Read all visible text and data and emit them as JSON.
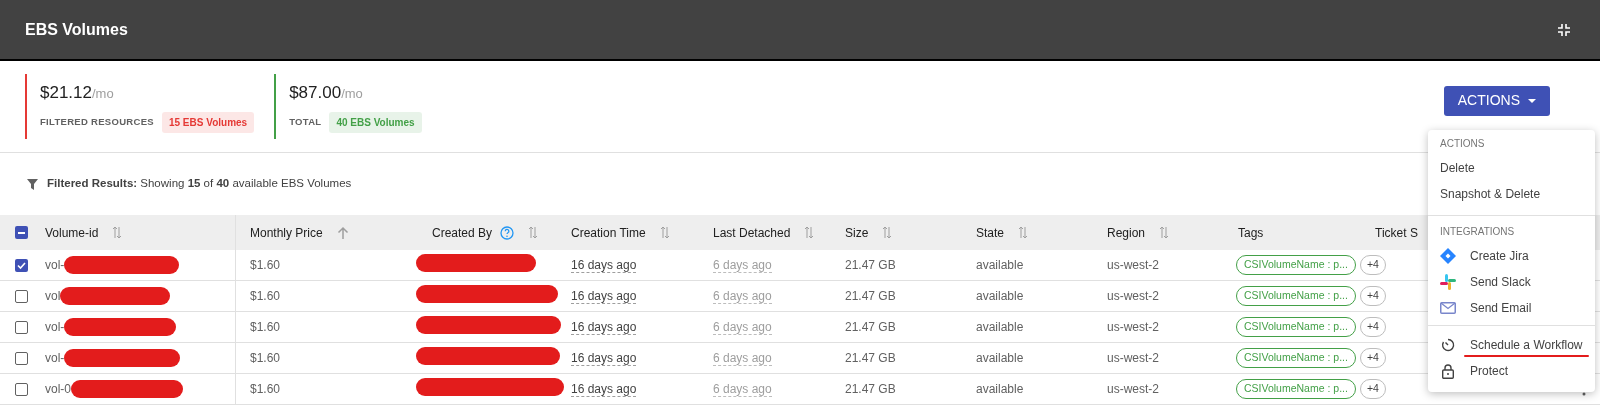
{
  "header": {
    "title": "EBS Volumes"
  },
  "summary": [
    {
      "amount": "$21.12",
      "unit": "/mo",
      "label": "FILTERED RESOURCES",
      "badge": "15 EBS Volumes",
      "color": "#e53935"
    },
    {
      "amount": "$87.00",
      "unit": "/mo",
      "label": "TOTAL",
      "badge": "40 EBS Volumes",
      "color": "#43a047"
    }
  ],
  "actions_button": {
    "label": "ACTIONS"
  },
  "filter_note": "**Filtered Results:** Showing **15** of **40** available EBS Volumes",
  "table": {
    "select_all_partial": true,
    "columns": [
      {
        "label": "Volume-id",
        "kind": "sortable"
      },
      {
        "label": "Monthly Price",
        "kind": "sorted"
      },
      {
        "label": "Created By",
        "kind": "sortable",
        "help": true
      },
      {
        "label": "Creation Time",
        "kind": "sortable"
      },
      {
        "label": "Last Detached",
        "kind": "sortable"
      },
      {
        "label": "Size",
        "kind": "sortable"
      },
      {
        "label": "State",
        "kind": "sortable"
      },
      {
        "label": "Region",
        "kind": "sortable"
      },
      {
        "label": "Tags",
        "kind": "plain"
      },
      {
        "label": "Ticket S",
        "kind": "plain"
      }
    ],
    "rows": [
      {
        "checked": true,
        "volume_id": "vol-",
        "price": "$1.60",
        "creation_time": "16 days ago",
        "last_detached": "6 days ago",
        "size": "21.47 GB",
        "state": "available",
        "region": "us-west-2",
        "tag": "CSIVolumeName : p...",
        "more_tags": "+4"
      },
      {
        "checked": false,
        "volume_id": "vol",
        "price": "$1.60",
        "creation_time": "16 days ago",
        "last_detached": "6 days ago",
        "size": "21.47 GB",
        "state": "available",
        "region": "us-west-2",
        "tag": "CSIVolumeName : p...",
        "more_tags": "+4"
      },
      {
        "checked": false,
        "volume_id": "vol-",
        "price": "$1.60",
        "creation_time": "16 days ago",
        "last_detached": "6 days ago",
        "size": "21.47 GB",
        "state": "available",
        "region": "us-west-2",
        "tag": "CSIVolumeName : p...",
        "more_tags": "+4"
      },
      {
        "checked": false,
        "volume_id": "vol-",
        "price": "$1.60",
        "creation_time": "16 days ago",
        "last_detached": "6 days ago",
        "size": "21.47 GB",
        "state": "available",
        "region": "us-west-2",
        "tag": "CSIVolumeName : p...",
        "more_tags": "+4"
      },
      {
        "checked": false,
        "volume_id": "vol-0",
        "price": "$1.60",
        "creation_time": "16 days ago",
        "last_detached": "6 days ago",
        "size": "21.47 GB",
        "state": "available",
        "region": "us-west-2",
        "tag": "CSIVolumeName : p...",
        "more_tags": "+4"
      }
    ]
  },
  "menu": [
    {
      "title": "ACTIONS",
      "items": [
        {
          "label": "Delete",
          "kind": "text",
          "underlined": false
        },
        {
          "label": "Snapshot & Delete",
          "kind": "text",
          "underlined": false
        }
      ]
    },
    {
      "title": "INTEGRATIONS",
      "items": [
        {
          "label": "Create Jira",
          "kind": "jira",
          "underlined": false
        },
        {
          "label": "Send Slack",
          "kind": "slack",
          "underlined": false
        },
        {
          "label": "Send Email",
          "kind": "email",
          "underlined": false
        }
      ]
    },
    {
      "items": [
        {
          "label": "Schedule a Workflow",
          "kind": "schedule",
          "underlined": true
        },
        {
          "label": "Protect",
          "kind": "lock",
          "underlined": false
        }
      ]
    }
  ]
}
